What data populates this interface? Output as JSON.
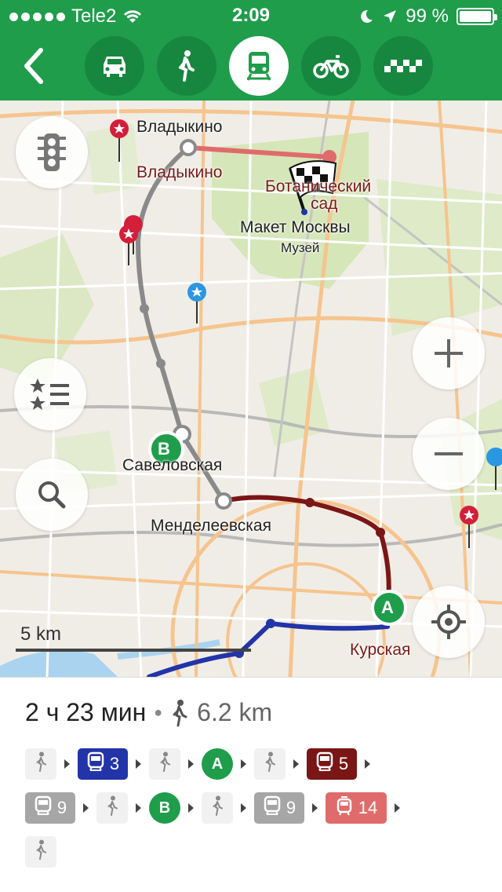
{
  "status_bar": {
    "carrier": "Tele2",
    "time": "2:09",
    "battery": "99 %",
    "battery_level": 0.99
  },
  "toolbar": {
    "back_icon": "chevron-left-icon",
    "modes": [
      {
        "icon": "car-icon",
        "active": false
      },
      {
        "icon": "pedestrian-icon",
        "active": false
      },
      {
        "icon": "transit-icon",
        "active": true
      },
      {
        "icon": "bicycle-icon",
        "active": false
      },
      {
        "icon": "taxi-icon",
        "active": false
      }
    ],
    "colors": {
      "bar": "#1f9d4b",
      "active": "#ffffff",
      "inactive": "#178740"
    }
  },
  "map": {
    "labels": {
      "vladykino_poi": "Владыкино",
      "vladykino_station": "Владыкино",
      "botanical_1": "Ботанический",
      "botanical_2": "сад",
      "maket": "Макет Москвы",
      "muzei": "Музей",
      "savelovskaya": "Савеловская",
      "mendeleevskaya": "Менделеевская",
      "kurskaya": "Курская"
    },
    "markers": {
      "start": "A",
      "end": "B"
    },
    "scale": "5 km",
    "controls": [
      "traffic-icon",
      "bookmarks-icon",
      "search-icon",
      "zoom-in-icon",
      "zoom-out-icon",
      "locate-icon"
    ]
  },
  "route": {
    "duration": "2 ч 23 мин",
    "walk_distance": "6.2 km",
    "steps_row1": [
      {
        "type": "walk"
      },
      {
        "type": "bus",
        "label": "3",
        "color": "#2234a8"
      },
      {
        "type": "walk"
      },
      {
        "type": "badge",
        "label": "A"
      },
      {
        "type": "walk"
      },
      {
        "type": "bus",
        "label": "5",
        "color": "#7b1616"
      }
    ],
    "steps_row2": [
      {
        "type": "bus",
        "label": "9",
        "color": "#a6a6a6"
      },
      {
        "type": "walk"
      },
      {
        "type": "badge",
        "label": "B"
      },
      {
        "type": "walk"
      },
      {
        "type": "bus",
        "label": "9",
        "color": "#a6a6a6"
      },
      {
        "type": "tram",
        "label": "14",
        "color": "#e06b6b"
      }
    ],
    "steps_row3": [
      {
        "type": "walk"
      }
    ]
  }
}
